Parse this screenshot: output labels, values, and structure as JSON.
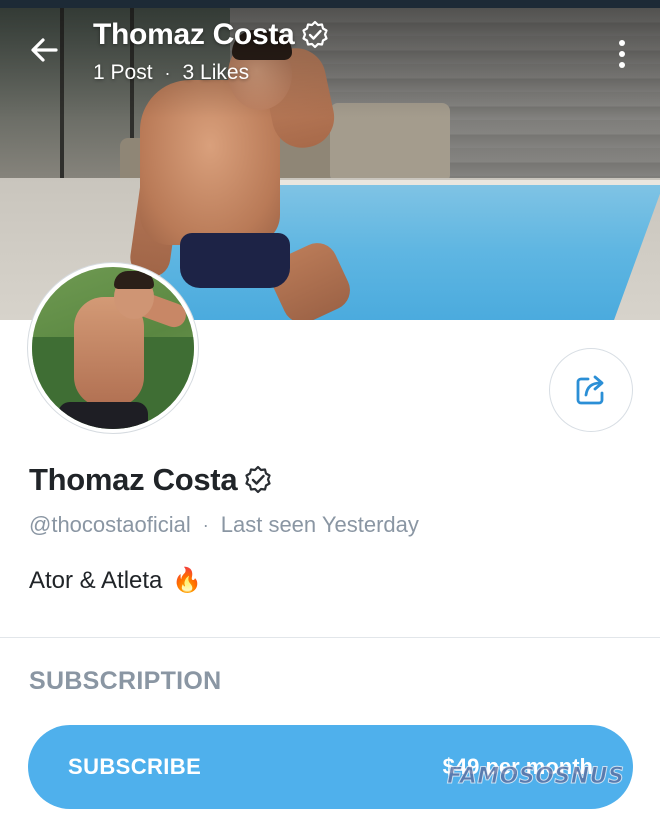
{
  "header": {
    "name": "Thomaz Costa",
    "posts": "1 Post",
    "likes": "3 Likes",
    "separator": "·"
  },
  "profile": {
    "name": "Thomaz Costa",
    "handle": "@thocostaoficial",
    "separator": "·",
    "last_seen": "Last seen Yesterday",
    "bio": "Ator & Atleta",
    "bio_emoji": "🔥"
  },
  "subscription": {
    "section_title": "SUBSCRIPTION",
    "button_label": "SUBSCRIBE",
    "price": "$49 per month"
  },
  "watermark": "FAMOSOSNUS",
  "icons": {
    "back": "arrow-left-icon",
    "more": "more-vertical-icon",
    "verified": "verified-badge-icon",
    "share": "share-icon"
  },
  "colors": {
    "accent": "#4fb0ec",
    "muted_text": "#8a96a3",
    "primary_text": "#202428"
  }
}
